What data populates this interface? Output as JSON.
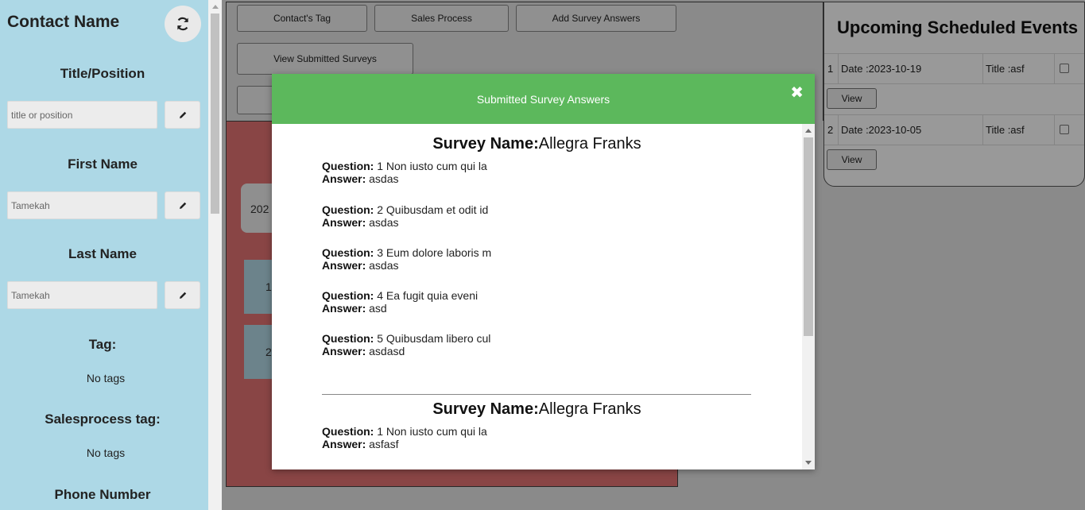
{
  "sidebar": {
    "title": "Contact Name",
    "fields": [
      {
        "label": "Title/Position",
        "placeholder": "title or position",
        "value": ""
      },
      {
        "label": "First Name",
        "placeholder": "",
        "value": "Tamekah"
      },
      {
        "label": "Last Name",
        "placeholder": "",
        "value": "Tamekah"
      }
    ],
    "tag_label": "Tag:",
    "tag_value": "No tags",
    "salesprocess_label": "Salesprocess tag:",
    "salesprocess_value": "No tags",
    "phone_label": "Phone Number"
  },
  "main": {
    "buttons": [
      "Contact's Tag",
      "Sales Process",
      "Add Survey Answers",
      "View Submitted Surveys"
    ],
    "card_text": "202",
    "list_items": [
      "1",
      "2"
    ]
  },
  "events": {
    "title": "Upcoming Scheduled Events",
    "rows": [
      {
        "num": "1",
        "date": "Date :2023-10-19",
        "title": "Title :asf"
      },
      {
        "num": "2",
        "date": "Date :2023-10-05",
        "title": "Title :asf"
      }
    ],
    "view_label": "View"
  },
  "modal": {
    "title": "Submitted Survey Answers",
    "close_symbol": "✖",
    "survey_label": "Survey Name:",
    "question_label": "Question:",
    "answer_label": "Answer:",
    "surveys": [
      {
        "name": "Allegra Franks",
        "items": [
          {
            "q": "1 Non iusto cum qui la",
            "a": "asdas"
          },
          {
            "q": "2 Quibusdam et odit id",
            "a": "asdas"
          },
          {
            "q": "3 Eum dolore laboris m",
            "a": "asdas"
          },
          {
            "q": "4 Ea fugit quia eveni",
            "a": "asd"
          },
          {
            "q": "5 Quibusdam libero cul",
            "a": "asdasd"
          }
        ]
      },
      {
        "name": "Allegra Franks",
        "items": [
          {
            "q": "1 Non iusto cum qui la",
            "a": "asfasf"
          }
        ]
      }
    ]
  },
  "colors": {
    "sidebar_bg": "#add8e6",
    "modal_header": "#5cb85c",
    "panel_red": "#e57373"
  }
}
